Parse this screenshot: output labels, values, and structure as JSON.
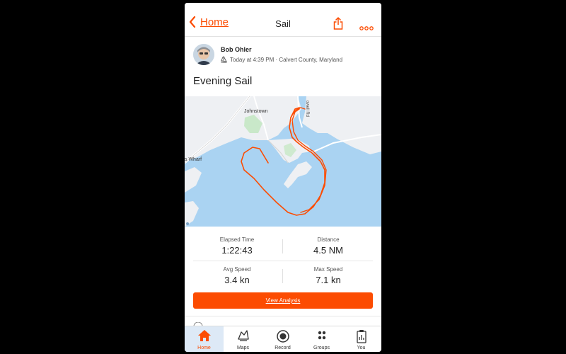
{
  "header": {
    "back_label": "Home",
    "title": "Sail",
    "share_icon": "share-icon",
    "more_icon": "more-icon"
  },
  "activity": {
    "athlete_name": "Bob Ohler",
    "meta": "Today at 4:39 PM · Calvert County, Maryland",
    "sport_icon": "sail-icon",
    "title": "Evening Sail"
  },
  "map": {
    "labels": {
      "johnstown": "Johnstown",
      "wharf": "s Wharf",
      "road": "owell Rd"
    },
    "route_color": "#fc4c02",
    "water_color": "#aad3f2",
    "land_color": "#eef0f3"
  },
  "stats": {
    "elapsed_label": "Elapsed Time",
    "elapsed_value": "1:22:43",
    "distance_label": "Distance",
    "distance_value": "4.5 NM",
    "avg_label": "Avg Speed",
    "avg_value": "3.4 kn",
    "max_label": "Max Speed",
    "max_value": "7.1 kn"
  },
  "view_analysis_label": "View Analysis",
  "tabs": [
    {
      "label": "Home",
      "icon": "home-icon",
      "active": true
    },
    {
      "label": "Maps",
      "icon": "maps-icon"
    },
    {
      "label": "Record",
      "icon": "record-icon"
    },
    {
      "label": "Groups",
      "icon": "groups-icon"
    },
    {
      "label": "You",
      "icon": "you-icon"
    }
  ],
  "colors": {
    "accent": "#fc4c02",
    "active_tab_bg": "#dde9f6"
  }
}
